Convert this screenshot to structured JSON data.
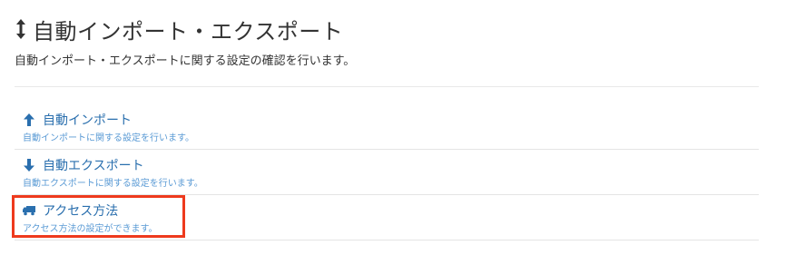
{
  "header": {
    "title": "自動インポート・エクスポート",
    "title_icon": "vertical-arrows-icon",
    "description": "自動インポート・エクスポートに関する設定の確認を行います。"
  },
  "menu": {
    "items": [
      {
        "icon": "arrow-up-icon",
        "label": "自動インポート",
        "description": "自動インポートに関する設定を行います。"
      },
      {
        "icon": "arrow-down-icon",
        "label": "自動エクスポート",
        "description": "自動エクスポートに関する設定を行います。"
      },
      {
        "icon": "truck-icon",
        "label": "アクセス方法",
        "description": "アクセス方法の設定ができます。"
      }
    ]
  },
  "colors": {
    "link": "#2a6fae",
    "sub_text": "#5b9bd5",
    "highlight": "#ee3a1d",
    "divider": "#e4e4e4"
  }
}
